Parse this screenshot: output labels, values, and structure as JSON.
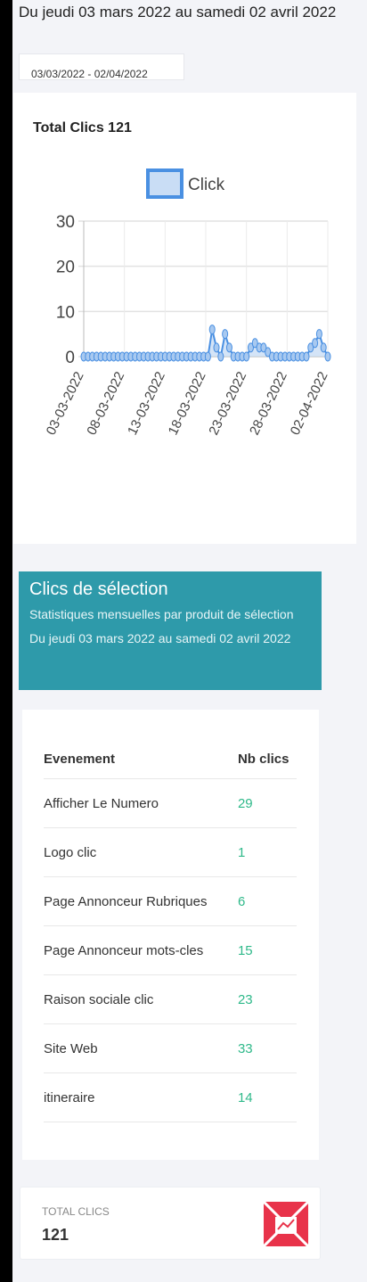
{
  "header": {
    "title": "Du jeudi 03 mars 2022 au samedi 02 avril 2022",
    "date_range": "03/03/2022 - 02/04/2022"
  },
  "chart_card": {
    "title": "Total Clics 121"
  },
  "chart_data": {
    "type": "line",
    "legend": "Click",
    "ylim": [
      0,
      30
    ],
    "yticks": [
      "0",
      "10",
      "20",
      "30"
    ],
    "xticks": [
      "03-03-2022",
      "08-03-2022",
      "13-03-2022",
      "18-03-2022",
      "23-03-2022",
      "28-03-2022",
      "02-04-2022"
    ],
    "series": [
      {
        "name": "Click",
        "values": [
          0,
          0,
          0,
          0,
          0,
          0,
          0,
          0,
          0,
          0,
          0,
          0,
          0,
          0,
          0,
          0,
          0,
          0,
          0,
          0,
          0,
          0,
          0,
          0,
          0,
          0,
          0,
          0,
          0,
          0,
          6,
          2,
          0,
          5,
          2,
          0,
          0,
          0,
          0,
          2,
          3,
          2,
          2,
          1,
          0,
          0,
          0,
          0,
          0,
          0,
          0,
          0,
          0,
          2,
          3,
          5,
          2,
          0
        ]
      }
    ],
    "color": "#4a90e2",
    "fill": "#c9ddf5"
  },
  "section": {
    "title": "Clics de sélection",
    "subtitle": "Statistiques mensuelles par produit de sélection Du jeudi 03 mars 2022 au samedi 02 avril 2022"
  },
  "table": {
    "headers": [
      "Evenement",
      "Nb clics"
    ],
    "rows": [
      [
        "Afficher Le Numero",
        "29"
      ],
      [
        "Logo clic",
        "1"
      ],
      [
        "Page Annonceur Rubriques",
        "6"
      ],
      [
        "Page Annonceur mots-cles",
        "15"
      ],
      [
        "Raison sociale clic",
        "23"
      ],
      [
        "Site Web",
        "33"
      ],
      [
        "itineraire",
        "14"
      ]
    ]
  },
  "total": {
    "label": "TOTAL CLICS",
    "value": "121",
    "icon": "chart-icon",
    "icon_color": "#e8334a"
  }
}
